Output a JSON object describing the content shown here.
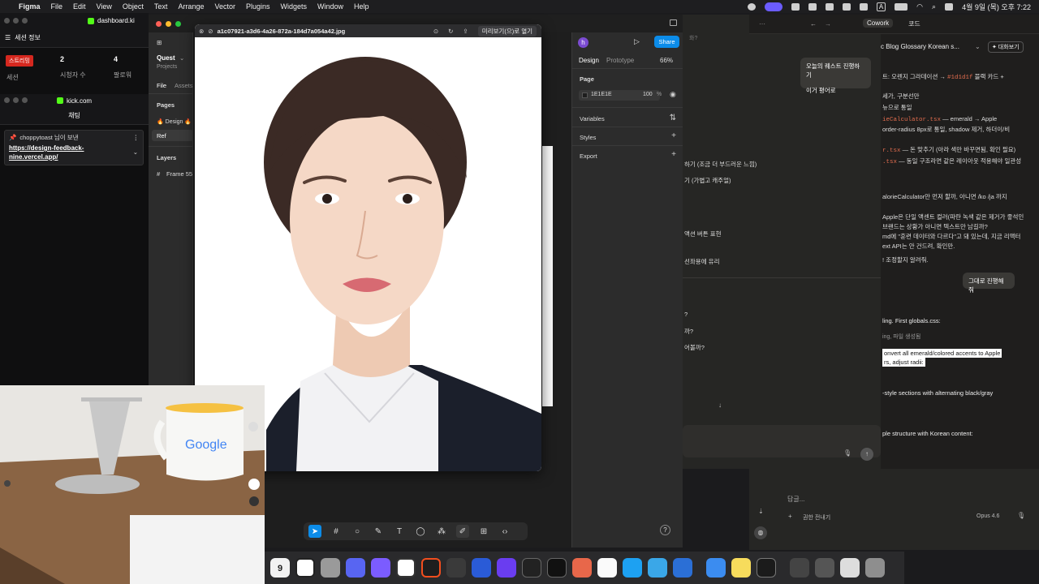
{
  "menubar": {
    "app_name": "Figma",
    "items": [
      "File",
      "Edit",
      "View",
      "Object",
      "Text",
      "Arrange",
      "Vector",
      "Plugins",
      "Widgets",
      "Window",
      "Help"
    ],
    "clock": "4월 9일 (목) 오후 7:22",
    "status_icon_a": "A"
  },
  "stream_panel": {
    "title": "세션 정보",
    "live_badge": "스트리밍",
    "session_label": "세션",
    "viewers_value": "2",
    "viewers_label": "시청자 수",
    "followers_value": "4",
    "followers_label": "팔로워",
    "dashboard_tab": "dashboard.ki",
    "kick_title": "kick.com",
    "chat_title": "채팅",
    "pinned_user": "choppytoast 님이 보낸",
    "pinned_link": "https://design-feedback-nine.vercel.app/"
  },
  "figma": {
    "project_name": "Quest",
    "project_sub": "Projects",
    "tab_file": "File",
    "tab_assets": "Assets",
    "pages_label": "Pages",
    "page_design": "🔥 Design 🔥 u",
    "page_ref": "Ref",
    "layers_label": "Layers",
    "layer_frame": "Frame 55",
    "right_tab_design": "Design",
    "right_tab_prototype": "Prototype",
    "zoom": "66%",
    "share_label": "Share",
    "avatar_letter": "h",
    "page_section": "Page",
    "page_color": "1E1E1E",
    "page_opacity": "100",
    "page_opacity_unit": "%",
    "variables_label": "Variables",
    "styles_label": "Styles",
    "export_label": "Export",
    "help": "?"
  },
  "preview": {
    "filename": "a1c07921-a3d6-4a26-872a-184d7a054a42.jpg",
    "open_with": "미리보기(으)로 열기"
  },
  "claude": {
    "top_tab": "Cowork",
    "top_tab2": "코드",
    "doc_title": "c Blog Glossary Korean s...",
    "share_btn": "✦ 대화보기",
    "bubble1_line1": "오늘의 퀘스트 진행하기",
    "bubble1_line2": "이거 평어로",
    "bubble2": "그대로 진행해줘",
    "lines": [
      {
        "t": "트: 오렌지 그라데이션 → ",
        "c": "#1d1d1f",
        "t2": " 블랙 카드 +"
      },
      {
        "t": "",
        "c": "",
        "t2": "세가, 구분선만"
      },
      {
        "t": "",
        "c": "",
        "t2": "뉴으로 통일"
      },
      {
        "t": "",
        "c": "ieCalculator.tsx",
        "t2": " — emerald → Apple"
      },
      {
        "t": "",
        "c": "",
        "t2": "order-radius 8px로 통일, shadow 제거, 하더이/비"
      },
      {
        "t": "",
        "c": "r.tsx",
        "t2": " — 돈 맞추기 (아라 색만 바꾸면됨, 확인 필요)"
      },
      {
        "t": "",
        "c": ".tsx",
        "t2": " — 동일 구조라면 같은 레이아웃 적용해야 일관성"
      }
    ],
    "mid_lines": [
      "하기 (조금 더 부드러운 느낌)",
      "기 (가볍고 캐주얼)",
      "alorieCalculator만 먼저 할까, 아니면 /ko /ja 까지",
      "Apple은 단일 액센트 컬러(파란 녹색 같은 제거가 좋석인",
      "브랜드는 상황가 아니면 텍스트만 남길까?",
      "md에 \"훈련 데이터와 다르다\"고 돼 있는데, 지금 리액터",
      "ext API는 안 건드려, 확인만.",
      "! 조정할지 알려줘."
    ],
    "left_lines": [
      "액션 버튼 표현",
      "선좌용에 유리"
    ],
    "q_lines": [
      "?",
      "까?",
      "어볼까?"
    ],
    "en_lines": [
      "ling. First globals.css:",
      "ing, 파일 생성됨",
      "onvert all emerald/colored accents to Apple",
      "rs, adjust radii:",
      "-style sections with alternating black/gray",
      "ple structure with Korean content:"
    ],
    "composer_placeholder": "답글...",
    "permission": "권한 전내기",
    "model": "Opus 4.6"
  },
  "dock": {
    "calendar_day": "9"
  }
}
